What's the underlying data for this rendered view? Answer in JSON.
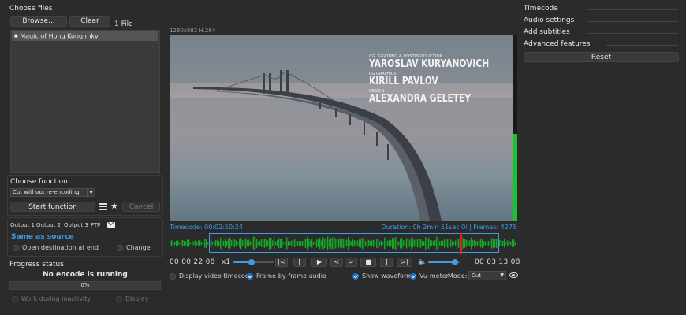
{
  "choose_files": {
    "title": "Choose files",
    "browse_label": "Browse...",
    "clear_label": "Clear",
    "file_count": "1 File",
    "files": [
      "Magic of Hong Kong.mkv"
    ]
  },
  "choose_function": {
    "title": "Choose function",
    "selected": "Cut without re-encoding",
    "start_label": "Start function",
    "cancel_label": "Cancel"
  },
  "output": {
    "tabs": [
      "Output 1",
      "Output 2",
      "Output 3",
      "FTP"
    ],
    "destination": "Same as source",
    "open_dest_label": "Open destination at end",
    "change_label": "Change"
  },
  "progress": {
    "title": "Progress status",
    "status": "No encode is running",
    "percent_text": "0%",
    "percent_value": 0,
    "work_inactivity_label": "Work during inactivity",
    "display_label": "Display"
  },
  "video": {
    "info": "1280x682 H.264",
    "credits": [
      {
        "role": "CG, GRADING & POSTPRODUCTION",
        "name": "YAROSLAV KURYANOVICH"
      },
      {
        "role": "CG GRAPHICS",
        "name": "KIRILL PAVLOV"
      },
      {
        "role": "DESIGN",
        "name": "ALEXANDRA GELETEY"
      }
    ],
    "timecode": "Timecode: 00:02:50:24",
    "duration": "Duration: 0h 2min 51sec 0i | Frames: 4275"
  },
  "transport": {
    "current_time": "00 00 22 08",
    "speed": "x1",
    "buttons": [
      "|<",
      "[",
      "▶",
      "<",
      ">",
      "■",
      "]",
      ">|"
    ],
    "end_time": "00 03 13 08",
    "speed_slider": 0.45,
    "volume_slider": 0.85
  },
  "options": {
    "display_timecode_label": "Display video timecode",
    "frame_audio_label": "Frame-by-frame audio",
    "show_waveform_label": "Show waveform",
    "vu_meter_label": "Vu-meter",
    "mode_label": "Mode:",
    "mode_value": "Cut"
  },
  "right_panel": {
    "sections": [
      "Timecode",
      "Audio settings",
      "Add subtitles",
      "Advanced features"
    ],
    "reset_label": "Reset"
  },
  "colors": {
    "accent": "#3e9be6",
    "waveform": "#16a82a",
    "playhead": "#e02020"
  }
}
